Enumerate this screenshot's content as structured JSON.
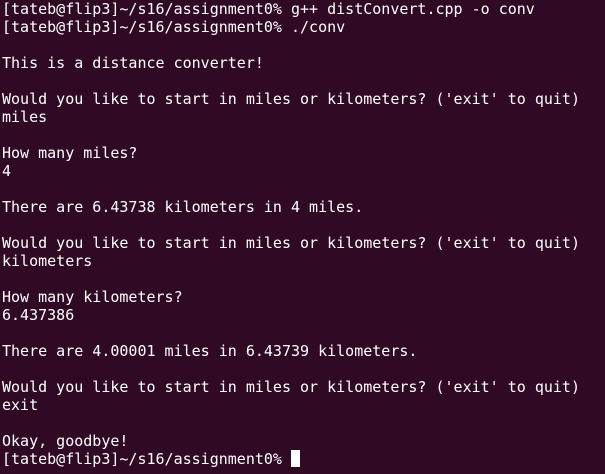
{
  "terminal": {
    "lines": [
      "[tateb@flip3]~/s16/assignment0% g++ distConvert.cpp -o conv",
      "[tateb@flip3]~/s16/assignment0% ./conv",
      "",
      "This is a distance converter!",
      "",
      "Would you like to start in miles or kilometers? ('exit' to quit)",
      "miles",
      "",
      "How many miles?",
      "4",
      "",
      "There are 6.43738 kilometers in 4 miles.",
      "",
      "Would you like to start in miles or kilometers? ('exit' to quit)",
      "kilometers",
      "",
      "How many kilometers?",
      "6.437386",
      "",
      "There are 4.00001 miles in 6.43739 kilometers.",
      "",
      "Would you like to start in miles or kilometers? ('exit' to quit)",
      "exit",
      "",
      "Okay, goodbye!"
    ],
    "prompt": "[tateb@flip3]~/s16/assignment0% ",
    "background_color": "#300a24",
    "text_color": "#ffffff"
  }
}
